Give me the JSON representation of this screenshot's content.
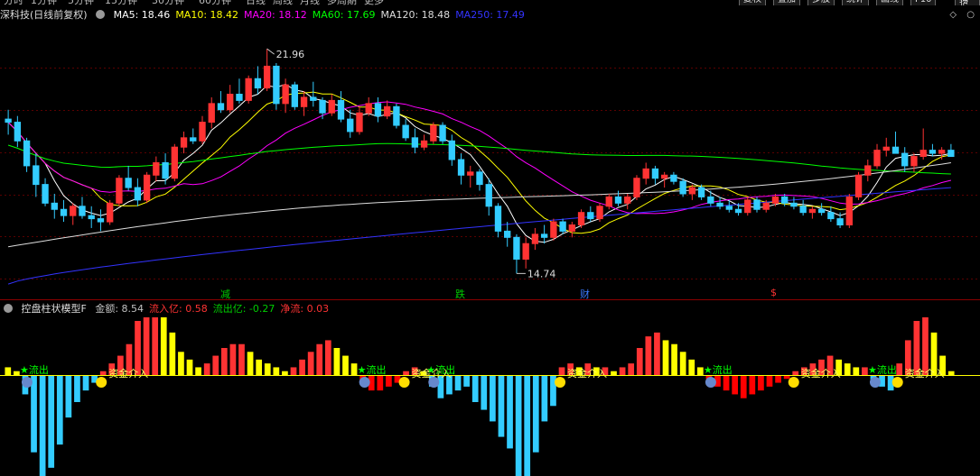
{
  "top_toolbar": {
    "periods": [
      "分时",
      "1分钟",
      "5分钟",
      "15分钟",
      "30分钟",
      "60分钟",
      "日线",
      "周线",
      "月线",
      "多周期",
      "更多"
    ],
    "buttons": [
      "复权",
      "叠加",
      "多股",
      "统计",
      "画线",
      "F10",
      "标记",
      "+自选",
      "返回"
    ]
  },
  "main_legend": {
    "title": "深科技(日线前复权)",
    "ma": [
      {
        "label": "MA5: 18.46",
        "color": "#ffffff"
      },
      {
        "label": "MA10: 18.42",
        "color": "#ffff00"
      },
      {
        "label": "MA20: 18.12",
        "color": "#ff00ff"
      },
      {
        "label": "MA60: 17.69",
        "color": "#00ff00"
      },
      {
        "label": "MA120: 18.48",
        "color": "#dddddd"
      },
      {
        "label": "MA250: 17.49",
        "color": "#3333ff"
      }
    ]
  },
  "corner_icons": [
    "diamond-icon",
    "circle-icon"
  ],
  "annotations": {
    "high_label": "21.96",
    "low_label": "14.74",
    "events": [
      {
        "text": "减",
        "color": "#00cc00",
        "x": 242
      },
      {
        "text": "跌",
        "color": "#00cc00",
        "x": 502
      },
      {
        "text": "财",
        "color": "#3a7bff",
        "x": 640
      },
      {
        "text": "$",
        "color": "#ff3333",
        "x": 851
      }
    ]
  },
  "indicator_legend": {
    "name": "控盘柱状模型F",
    "items": [
      {
        "label": "金额: 8.54",
        "color": "#c0c0c0"
      },
      {
        "label": "流入亿: 0.58",
        "color": "#ff3333"
      },
      {
        "label": "流出亿: -0.27",
        "color": "#00cc00"
      },
      {
        "label": "净流: 0.03",
        "color": "#ff3333"
      }
    ]
  },
  "indicator_markers": {
    "outflow_label": "流出",
    "inflow_label": "资金介入",
    "flow_label": "资金流出"
  },
  "colors": {
    "up": "#ff3333",
    "down": "#33ccff",
    "ind_pos_red": "#ff3333",
    "ind_pos_yellow": "#ffff00",
    "ind_neg_red": "#ff0000",
    "ind_neg_cyan": "#33ccff"
  },
  "chart_data": {
    "type": "candlestick",
    "symbol": "深科技",
    "ylim": [
      14.2,
      22.6
    ],
    "max_price": 21.96,
    "min_price": 14.74,
    "ohlc": [
      [
        19.7,
        20.0,
        19.2,
        19.6
      ],
      [
        19.6,
        19.8,
        18.8,
        19.0
      ],
      [
        19.0,
        19.1,
        18.0,
        18.2
      ],
      [
        18.2,
        18.6,
        17.2,
        17.6
      ],
      [
        17.6,
        17.8,
        16.9,
        17.0
      ],
      [
        17.0,
        17.3,
        16.5,
        16.8
      ],
      [
        16.8,
        17.1,
        16.4,
        16.6
      ],
      [
        16.6,
        17.0,
        16.3,
        16.9
      ],
      [
        16.9,
        17.2,
        16.5,
        16.6
      ],
      [
        16.6,
        16.9,
        16.2,
        16.5
      ],
      [
        16.5,
        16.8,
        16.1,
        16.4
      ],
      [
        16.4,
        17.1,
        16.3,
        17.0
      ],
      [
        17.0,
        17.9,
        16.9,
        17.8
      ],
      [
        17.8,
        18.2,
        17.4,
        17.5
      ],
      [
        17.5,
        17.8,
        16.9,
        17.1
      ],
      [
        17.1,
        18.0,
        17.0,
        17.9
      ],
      [
        17.9,
        18.5,
        17.7,
        18.3
      ],
      [
        18.3,
        18.6,
        17.6,
        17.8
      ],
      [
        17.8,
        18.9,
        17.7,
        18.8
      ],
      [
        18.8,
        19.3,
        18.6,
        19.1
      ],
      [
        19.1,
        19.4,
        18.9,
        19.0
      ],
      [
        19.0,
        19.8,
        18.9,
        19.6
      ],
      [
        19.6,
        20.4,
        19.4,
        20.2
      ],
      [
        20.2,
        20.6,
        19.9,
        20.0
      ],
      [
        20.0,
        20.8,
        19.9,
        20.5
      ],
      [
        20.5,
        21.0,
        20.2,
        20.3
      ],
      [
        20.3,
        21.1,
        20.2,
        21.0
      ],
      [
        21.0,
        21.4,
        20.5,
        20.7
      ],
      [
        20.7,
        21.96,
        20.6,
        21.4
      ],
      [
        21.4,
        21.5,
        20.0,
        20.2
      ],
      [
        20.2,
        21.0,
        19.9,
        20.8
      ],
      [
        20.8,
        20.9,
        20.0,
        20.1
      ],
      [
        20.1,
        20.6,
        19.8,
        20.4
      ],
      [
        20.4,
        20.9,
        20.1,
        20.3
      ],
      [
        20.3,
        20.4,
        19.7,
        19.9
      ],
      [
        19.9,
        20.5,
        19.8,
        20.3
      ],
      [
        20.3,
        20.6,
        19.6,
        19.7
      ],
      [
        19.7,
        20.0,
        19.1,
        19.3
      ],
      [
        19.3,
        20.1,
        19.2,
        19.9
      ],
      [
        19.9,
        20.4,
        19.8,
        20.2
      ],
      [
        20.2,
        20.4,
        19.6,
        19.8
      ],
      [
        19.8,
        20.3,
        19.7,
        20.1
      ],
      [
        20.1,
        20.2,
        19.4,
        19.5
      ],
      [
        19.5,
        19.7,
        19.0,
        19.1
      ],
      [
        19.1,
        19.4,
        18.6,
        18.8
      ],
      [
        18.8,
        19.2,
        18.7,
        19.0
      ],
      [
        19.0,
        19.6,
        18.9,
        19.5
      ],
      [
        19.5,
        19.6,
        18.9,
        19.0
      ],
      [
        19.0,
        19.2,
        18.2,
        18.4
      ],
      [
        18.4,
        18.6,
        17.6,
        17.9
      ],
      [
        17.9,
        18.2,
        17.5,
        18.0
      ],
      [
        18.0,
        18.1,
        17.4,
        17.6
      ],
      [
        17.6,
        17.8,
        16.6,
        16.9
      ],
      [
        16.9,
        17.0,
        15.9,
        16.1
      ],
      [
        16.1,
        16.4,
        15.6,
        15.9
      ],
      [
        15.9,
        16.0,
        14.74,
        15.2
      ],
      [
        15.2,
        15.9,
        14.9,
        15.7
      ],
      [
        15.7,
        16.2,
        15.5,
        16.0
      ],
      [
        16.0,
        16.3,
        15.7,
        15.9
      ],
      [
        15.9,
        16.5,
        15.8,
        16.4
      ],
      [
        16.4,
        16.5,
        16.0,
        16.1
      ],
      [
        16.1,
        16.4,
        15.9,
        16.3
      ],
      [
        16.3,
        16.8,
        16.2,
        16.7
      ],
      [
        16.7,
        16.9,
        16.4,
        16.5
      ],
      [
        16.5,
        17.0,
        16.4,
        16.9
      ],
      [
        16.9,
        17.3,
        16.8,
        17.2
      ],
      [
        17.2,
        17.4,
        16.9,
        17.0
      ],
      [
        17.0,
        17.3,
        16.8,
        17.2
      ],
      [
        17.2,
        17.9,
        17.1,
        17.8
      ],
      [
        17.8,
        18.3,
        17.6,
        18.1
      ],
      [
        18.1,
        18.2,
        17.6,
        17.8
      ],
      [
        17.8,
        18.0,
        17.5,
        17.9
      ],
      [
        17.9,
        18.0,
        17.6,
        17.7
      ],
      [
        17.7,
        17.8,
        17.2,
        17.3
      ],
      [
        17.3,
        17.6,
        17.1,
        17.5
      ],
      [
        17.5,
        17.6,
        17.1,
        17.2
      ],
      [
        17.2,
        17.4,
        16.9,
        17.0
      ],
      [
        17.0,
        17.2,
        16.8,
        16.9
      ],
      [
        16.9,
        17.1,
        16.7,
        16.8
      ],
      [
        16.8,
        17.0,
        16.6,
        16.7
      ],
      [
        16.7,
        17.2,
        16.6,
        17.1
      ],
      [
        17.1,
        17.2,
        16.7,
        16.8
      ],
      [
        16.8,
        17.1,
        16.7,
        17.0
      ],
      [
        17.0,
        17.3,
        16.9,
        17.2
      ],
      [
        17.2,
        17.3,
        16.9,
        17.0
      ],
      [
        17.0,
        17.2,
        16.8,
        16.9
      ],
      [
        16.9,
        17.1,
        16.6,
        16.7
      ],
      [
        16.7,
        16.9,
        16.5,
        16.8
      ],
      [
        16.8,
        17.0,
        16.6,
        16.7
      ],
      [
        16.7,
        16.9,
        16.4,
        16.5
      ],
      [
        16.5,
        16.7,
        16.2,
        16.3
      ],
      [
        16.3,
        17.3,
        16.2,
        17.2
      ],
      [
        17.2,
        18.0,
        17.1,
        17.9
      ],
      [
        17.9,
        18.4,
        17.7,
        18.2
      ],
      [
        18.2,
        18.9,
        18.1,
        18.7
      ],
      [
        18.7,
        19.1,
        18.5,
        18.8
      ],
      [
        18.8,
        19.3,
        18.6,
        18.6
      ],
      [
        18.6,
        18.8,
        18.0,
        18.2
      ],
      [
        18.2,
        18.6,
        18.0,
        18.5
      ],
      [
        18.5,
        19.4,
        18.4,
        18.7
      ],
      [
        18.7,
        18.9,
        18.5,
        18.6
      ],
      [
        18.6,
        18.8,
        18.4,
        18.7
      ],
      [
        18.7,
        18.9,
        18.5,
        18.5
      ]
    ],
    "ma_values": {
      "MA5": 18.46,
      "MA10": 18.42,
      "MA20": 18.12,
      "MA60": 17.69,
      "MA120": 18.48,
      "MA250": 17.49
    },
    "indicator": {
      "name": "控盘柱状模型F",
      "values": [
        0.2,
        0.1,
        -0.5,
        -2.0,
        -2.7,
        -2.4,
        -1.8,
        -1.1,
        -0.7,
        -0.4,
        -0.2,
        0.1,
        0.3,
        0.5,
        0.8,
        1.4,
        1.7,
        1.8,
        1.5,
        1.1,
        0.6,
        0.4,
        0.2,
        0.3,
        0.5,
        0.7,
        0.8,
        0.8,
        0.6,
        0.4,
        0.3,
        0.2,
        0.1,
        0.2,
        0.4,
        0.6,
        0.8,
        0.9,
        0.7,
        0.5,
        0.3,
        -0.2,
        -0.4,
        -0.4,
        -0.3,
        -0.2,
        0.1,
        0.2,
        0.1,
        -0.3,
        -0.6,
        -0.5,
        -0.4,
        -0.3,
        -0.7,
        -0.9,
        -1.2,
        -1.6,
        -1.9,
        -2.8,
        -2.7,
        -2.0,
        -1.2,
        -0.8,
        0.2,
        0.3,
        0.2,
        0.3,
        0.2,
        0.2,
        0.1,
        0.2,
        0.3,
        0.7,
        1.0,
        1.1,
        0.9,
        0.8,
        0.6,
        0.4,
        0.2,
        -0.1,
        -0.3,
        -0.4,
        -0.5,
        -0.6,
        -0.5,
        -0.4,
        -0.3,
        -0.2,
        -0.1,
        0.1,
        0.2,
        0.3,
        0.4,
        0.5,
        0.4,
        0.3,
        0.2,
        0.2,
        -0.2,
        -0.3,
        -0.4,
        0.3,
        0.9,
        1.4,
        1.6,
        1.1,
        0.5,
        0.1
      ],
      "pos_color_rule": "rising = red, falling = yellow",
      "neg_color_rule": "alternating red / cyan blocks"
    }
  }
}
